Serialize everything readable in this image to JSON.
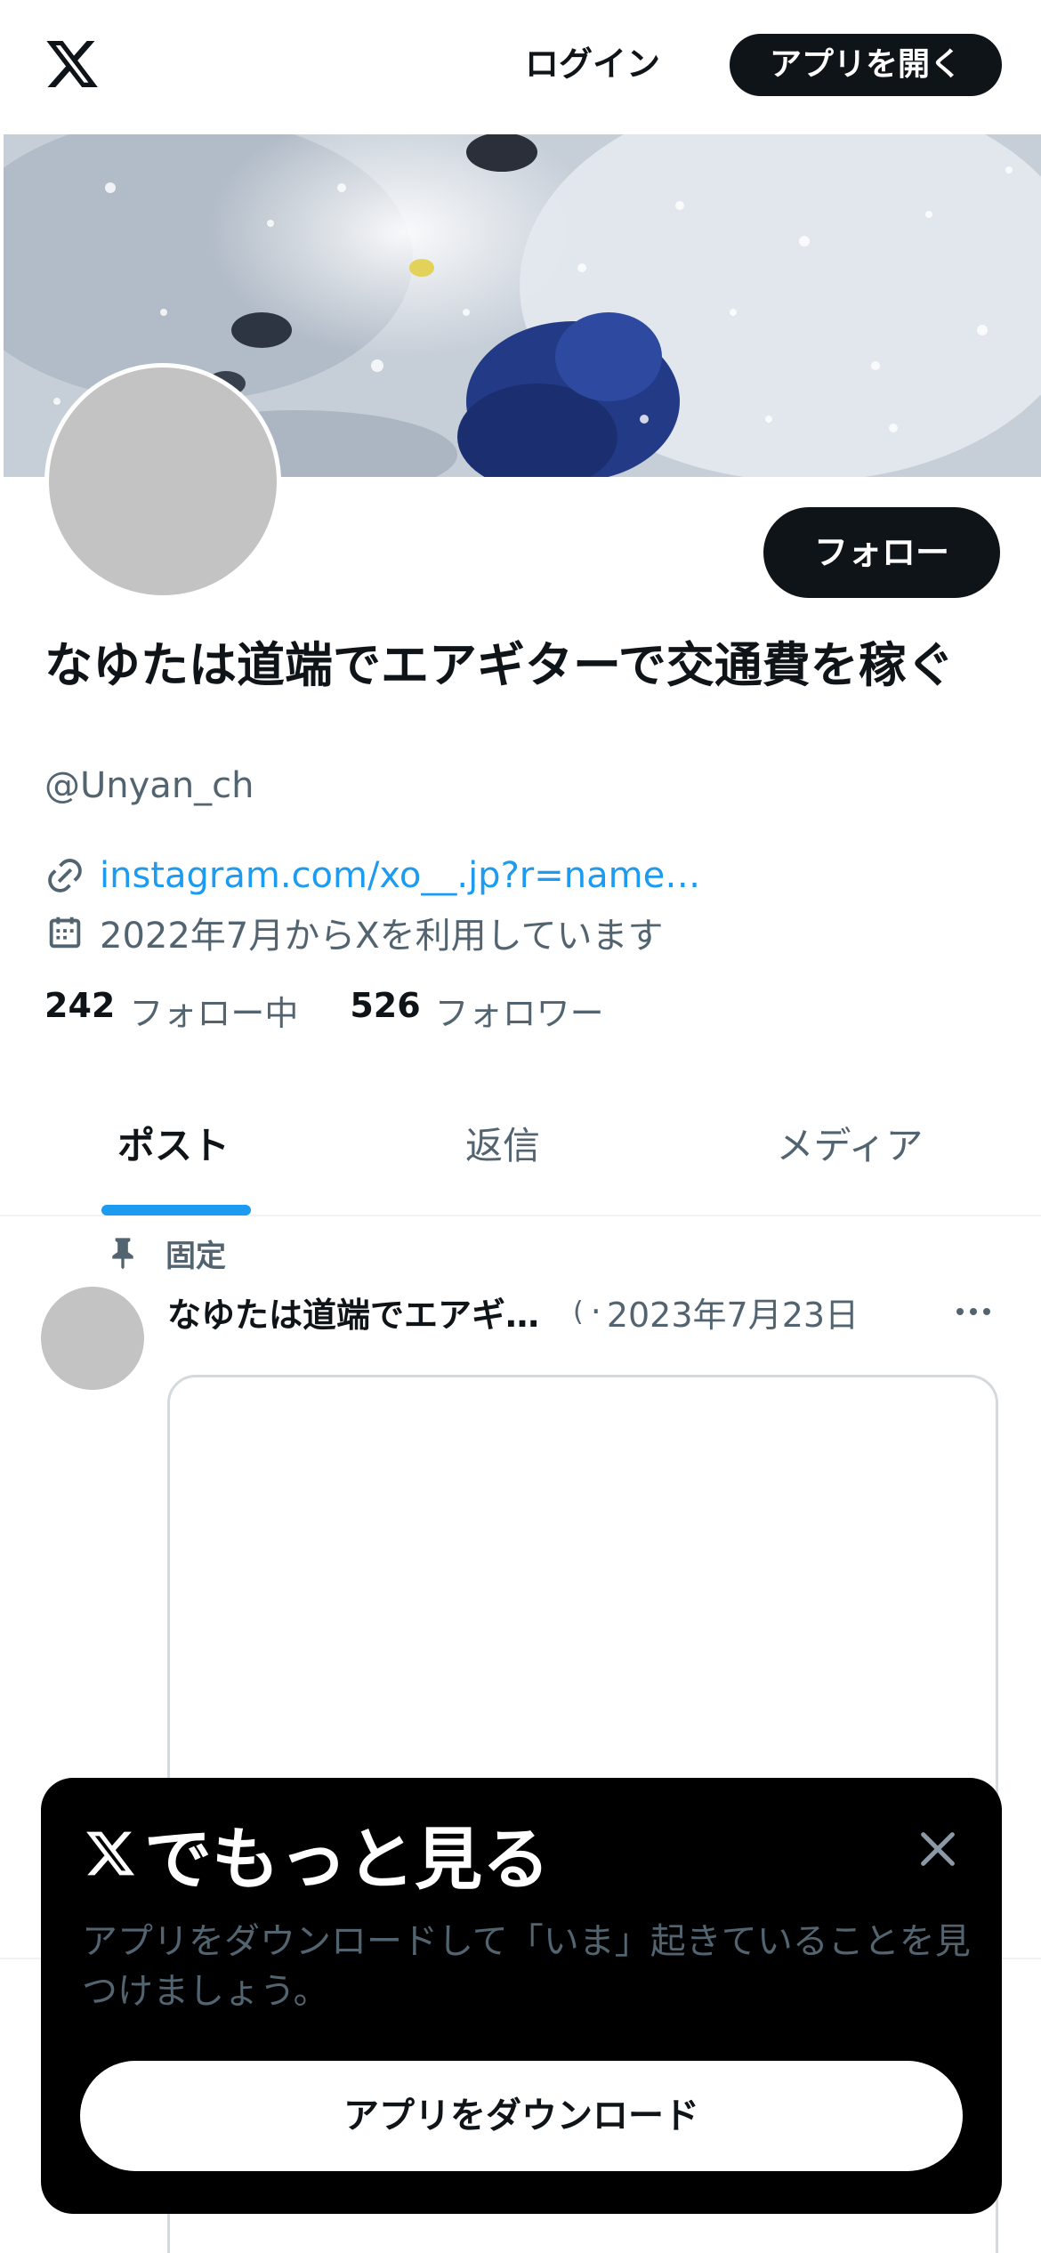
{
  "header": {
    "logo": "x-logo",
    "login_label": "ログイン",
    "open_app_label": "アプリを開く"
  },
  "profile": {
    "display_name": "なゆたは道端でエアギターで交通費を稼ぐ",
    "handle": "@Unyan_ch",
    "link_text": "instagram.com/xo__.jp?r=name…",
    "joined_text": "2022年7月からXを利用しています",
    "follow_label": "フォロー",
    "stats": {
      "following_count": "242",
      "following_label": "フォロー中",
      "followers_count": "526",
      "followers_label": "フォロワー"
    }
  },
  "tabs": [
    {
      "label": "ポスト",
      "active": true
    },
    {
      "label": "返信",
      "active": false
    },
    {
      "label": "メディア",
      "active": false
    }
  ],
  "pinned_post": {
    "pinned_label": "固定",
    "author": "なゆたは道端でエアギ…",
    "handle_fragment": "(",
    "separator": "·",
    "date": "2023年7月23日"
  },
  "promo": {
    "title": "でもっと見る",
    "description": "アプリをダウンロードして「いま」起きていることを見つけましょう。",
    "download_label": "アプリをダウンロード"
  },
  "colors": {
    "accent": "#1d9bf0",
    "text_primary": "#0f1419",
    "text_secondary": "#536471",
    "avatar_placeholder": "#c3c3c3"
  }
}
